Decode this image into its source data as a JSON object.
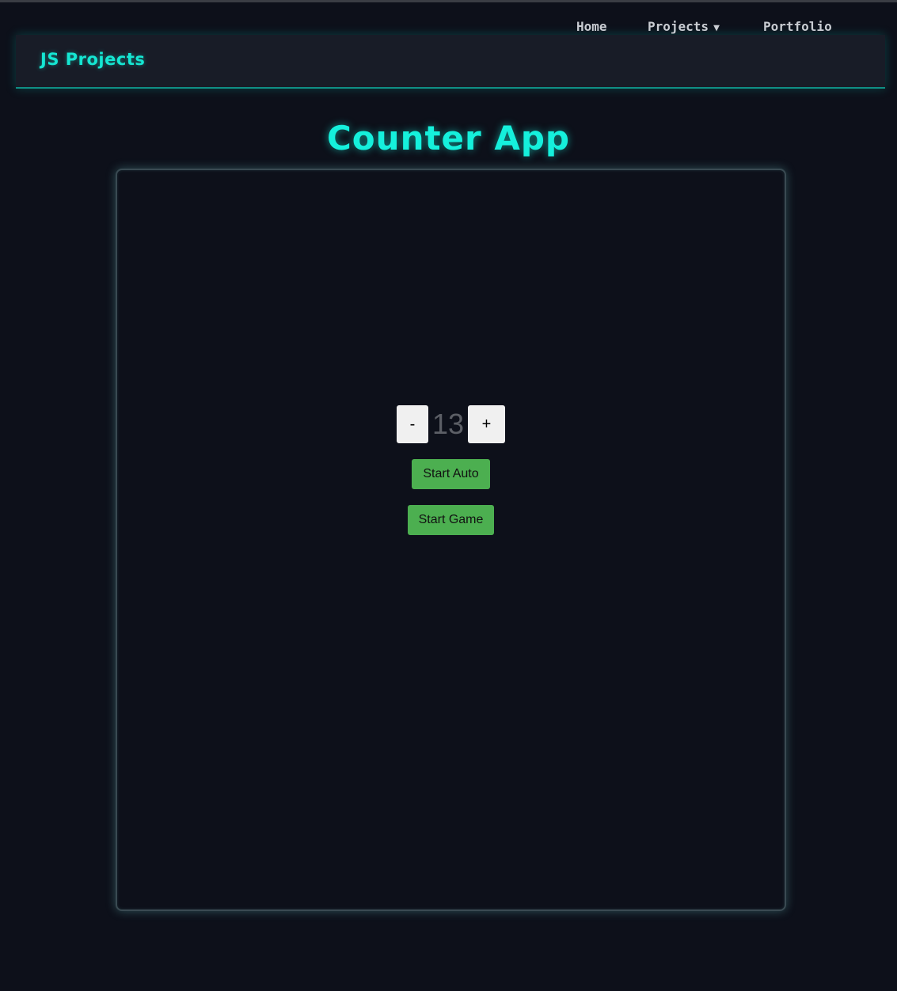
{
  "navbar": {
    "brand": "JS Projects",
    "links": [
      {
        "label": "Home"
      },
      {
        "label": "Projects",
        "caret": "▼"
      },
      {
        "label": "Portfolio"
      }
    ]
  },
  "page": {
    "title": "Counter App"
  },
  "counter": {
    "decrement_label": "-",
    "value": "13",
    "increment_label": "+",
    "auto_label": "Start Auto",
    "game_label": "Start Game"
  },
  "colors": {
    "background": "#0d101a",
    "navbar_bg": "#181c27",
    "accent": "#15f0dc",
    "button_green": "#4caf50",
    "button_light": "#f0f0f0",
    "counter_text": "#5c5f66"
  }
}
